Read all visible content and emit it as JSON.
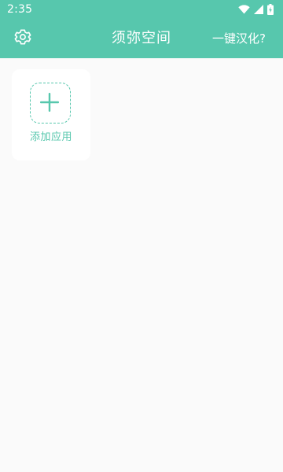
{
  "status_bar": {
    "time": "2:35",
    "icons": [
      "wifi-icon",
      "signal-icon",
      "battery-charging-icon"
    ]
  },
  "app_bar": {
    "settings_icon": "gear-icon",
    "title": "须弥空间",
    "translate_label": "一键汉化?"
  },
  "main": {
    "apps": [
      {
        "label": "添加应用",
        "icon": "plus-icon"
      }
    ]
  },
  "colors": {
    "accent": "#57c7ad",
    "background": "#fafafa",
    "card": "#ffffff"
  }
}
